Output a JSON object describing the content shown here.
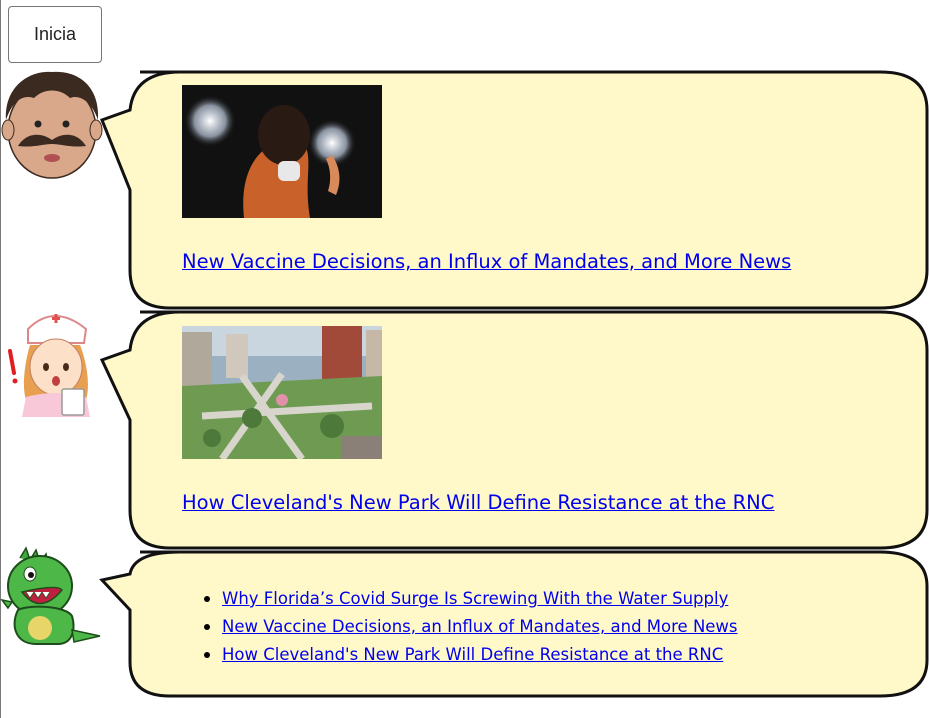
{
  "controls": {
    "start_label": "Inicia"
  },
  "messages": [
    {
      "avatar": "man-mustache-avatar",
      "headline": "New Vaccine Decisions, an Influx of Mandates, and More News"
    },
    {
      "avatar": "nurse-avatar",
      "headline": "How Cleveland's New Park Will Define Resistance at the RNC"
    }
  ],
  "list_message": {
    "avatar": "green-monster-avatar",
    "links": [
      "Why Florida’s Covid Surge Is Screwing With the Water Supply",
      "New Vaccine Decisions, an Influx of Mandates, and More News",
      "How Cleveland's New Park Will Define Resistance at the RNC"
    ]
  },
  "colors": {
    "bubble_fill": "#fff8c8",
    "bubble_stroke": "#111111",
    "link": "#0000ee"
  }
}
